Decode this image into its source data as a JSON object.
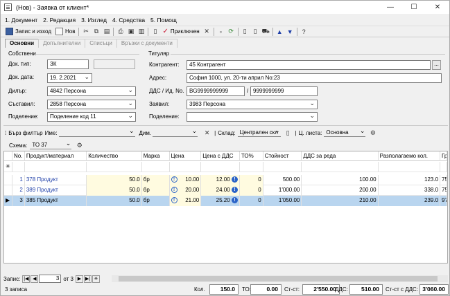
{
  "window": {
    "title": "(Нов) - Заявка от клиент*"
  },
  "menu": [
    "1. Документ",
    "2. Редакция",
    "3. Изглед",
    "4. Средства",
    "5. Помощ"
  ],
  "toolbar": {
    "save_close": "Запис и изход",
    "new": "Нов",
    "posted": "Приключен"
  },
  "tabs": [
    "Основни",
    "Допълнителни",
    "Списъци",
    "Връзки с документи"
  ],
  "own": {
    "group_title": "Собствени",
    "doc_type_label": "Док. тип:",
    "doc_type": "ЗК",
    "doc_date_label": "Док. дата:",
    "doc_date": "19.  2.2021",
    "dealer_label": "Дилър:",
    "dealer": "4842 Персона",
    "author_label": "Съставил:",
    "author": "2858 Персона",
    "division_label": "Поделение:",
    "division": "Поделение код 11"
  },
  "holder": {
    "group_title": "Титуляр",
    "partner_label": "Контрагент:",
    "partner": "45 Контрагент",
    "address_label": "Адрес:",
    "address": "София 1000, ул. 20-ти април No:23",
    "vat_label": "ДДС / Ид. No.",
    "vat": "BG9999999999",
    "slash": "/",
    "id_no": "9999999999",
    "requester_label": "Заявил:",
    "requester": "3983 Персона",
    "division_label": "Поделение:",
    "division": ""
  },
  "filter": {
    "quick_label": "Бърз филтър",
    "name_label": "Име:",
    "dim_label": "Дим.",
    "warehouse_label": "Склад:",
    "warehouse": "Централен скл",
    "pricelist_label": "Ц. листа:",
    "pricelist": "Основна",
    "scheme_label": "Схема:",
    "scheme": "ТО 37"
  },
  "grid": {
    "headers": [
      "No.",
      "Продукт/материал",
      "Количество",
      "Марка",
      "Цена",
      "Цена с ДДС",
      "ТО%",
      "Стойност",
      "ДДС за реда",
      "Разполагаемо кол.",
      "Гр"
    ],
    "rows": [
      {
        "no": "1",
        "product": "378 Продукт",
        "qty": "50.0",
        "unit": "бр",
        "price": "10.00",
        "price_vat": "12.00",
        "to": "0",
        "value": "500.00",
        "vat_row": "100.00",
        "avail": "123.0",
        "gr": "75"
      },
      {
        "no": "2",
        "product": "389 Продукт",
        "qty": "50.0",
        "unit": "бр",
        "price": "20.00",
        "price_vat": "24.00",
        "to": "0",
        "value": "1'000.00",
        "vat_row": "200.00",
        "avail": "338.0",
        "gr": "75"
      },
      {
        "no": "3",
        "product": "385 Продукт",
        "qty": "50.0",
        "unit": "бр",
        "price": "21.00",
        "price_vat": "25.20",
        "to": "0",
        "value": "1'050.00",
        "vat_row": "210.00",
        "avail": "239.0",
        "gr": "97"
      }
    ]
  },
  "nav": {
    "label": "Запис:",
    "current": "3",
    "of": "от 3"
  },
  "status": {
    "count": "3 записа",
    "qty_label": "Кол.",
    "qty": "150.0",
    "to_label": "ТО:",
    "to": "0.00",
    "sum_label": "Ст-ст:",
    "sum": "2'550.00",
    "vat_label": "ДДС:",
    "vat": "510.00",
    "sum_vat_label": "Ст-ст с ДДС:",
    "sum_vat": "3'060.00"
  }
}
